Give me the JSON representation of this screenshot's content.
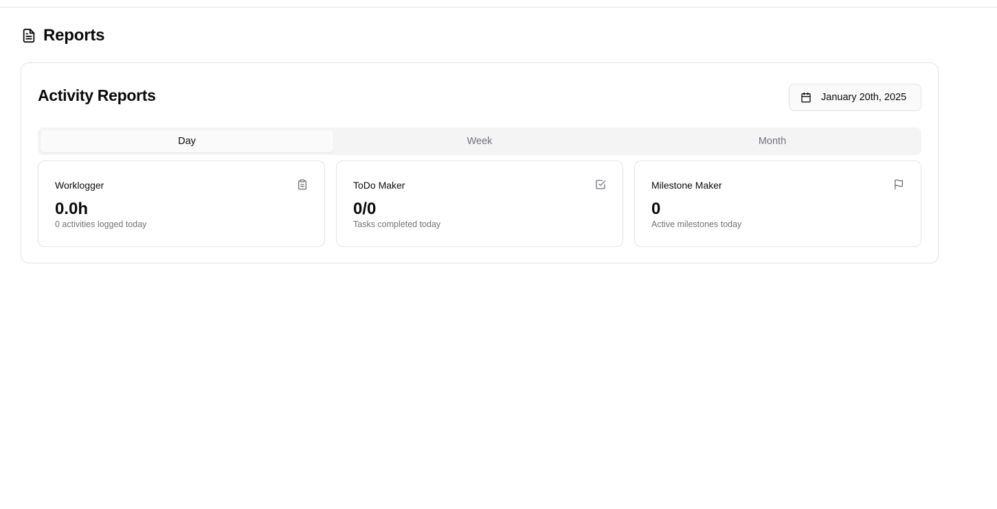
{
  "page": {
    "title": "Reports",
    "icon": "file-text-icon"
  },
  "report": {
    "title": "Activity Reports",
    "date_label": "January 20th, 2025",
    "date_icon": "calendar-icon",
    "tabs": [
      {
        "label": "Day",
        "active": true
      },
      {
        "label": "Week",
        "active": false
      },
      {
        "label": "Month",
        "active": false
      }
    ],
    "stats": [
      {
        "title": "Worklogger",
        "value": "0.0h",
        "subtitle": "0 activities logged today",
        "icon": "clipboard-icon"
      },
      {
        "title": "ToDo Maker",
        "value": "0/0",
        "subtitle": "Tasks completed today",
        "icon": "checkbox-icon"
      },
      {
        "title": "Milestone Maker",
        "value": "0",
        "subtitle": "Active milestones today",
        "icon": "flag-icon"
      }
    ]
  },
  "colors": {
    "border": "#e4e4e7",
    "muted_text": "#71717a",
    "tab_background": "#f4f4f5"
  }
}
